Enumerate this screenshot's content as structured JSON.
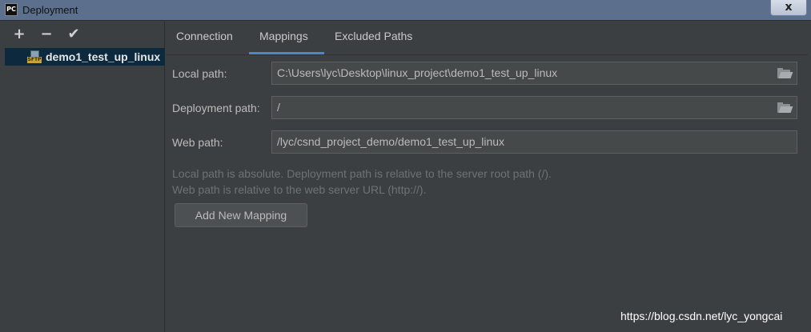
{
  "window": {
    "app_icon": "PC",
    "title": "Deployment",
    "close_label": "x"
  },
  "toolbar": {
    "add_symbol": "+",
    "remove_symbol": "−",
    "apply_symbol": "✔"
  },
  "servers": [
    {
      "name": "demo1_test_up_linux",
      "icon": "sftp-icon",
      "icon_label": "SFTP",
      "selected": true
    }
  ],
  "tabs": [
    {
      "label": "Connection",
      "active": false
    },
    {
      "label": "Mappings",
      "active": true
    },
    {
      "label": "Excluded Paths",
      "active": false
    }
  ],
  "mapping": {
    "local_path_label": "Local path:",
    "local_path_value": "C:\\Users\\lyc\\Desktop\\linux_project\\demo1_test_up_linux",
    "deployment_path_label": "Deployment path:",
    "deployment_path_value": "/",
    "web_path_label": "Web path:",
    "web_path_value": "/lyc/csnd_project_demo/demo1_test_up_linux",
    "hint_line1": "Local path is absolute. Deployment path is relative to the server root path (/).",
    "hint_line2": "Web path is relative to the web server URL (http://).",
    "add_button_label": "Add New Mapping"
  },
  "watermark": "https://blog.csdn.net/lyc_yongcai",
  "colors": {
    "background": "#3c3f41",
    "selection": "#0d293e",
    "tab_accent": "#4a88c7",
    "titlebar": "#5c6f8c"
  }
}
